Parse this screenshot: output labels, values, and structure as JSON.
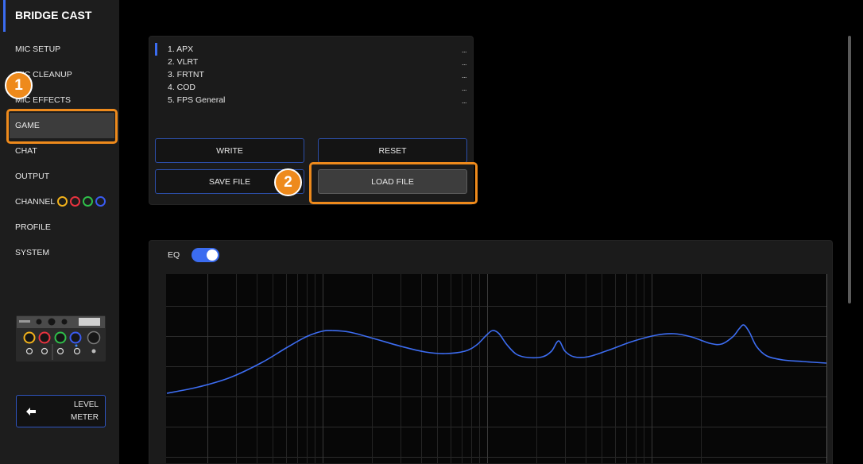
{
  "app": {
    "title": "BRIDGE CAST"
  },
  "sidebar": {
    "items": [
      {
        "label": "MIC SETUP"
      },
      {
        "label": "MIC CLEANUP"
      },
      {
        "label": "MIC EFFECTS"
      },
      {
        "label": "GAME",
        "selected": true
      },
      {
        "label": "CHAT"
      },
      {
        "label": "OUTPUT"
      },
      {
        "label": "CHANNEL"
      },
      {
        "label": "PROFILE"
      },
      {
        "label": "SYSTEM"
      }
    ],
    "channel_colors": [
      "#f2b21b",
      "#e8333f",
      "#2fbf4a",
      "#3a5bf0"
    ],
    "level_meter": {
      "line1": "LEVEL",
      "line2": "METER",
      "icon": "arrow-left-icon"
    }
  },
  "presets": {
    "items": [
      {
        "label": "1. APX",
        "menu": "...",
        "selected": true
      },
      {
        "label": "2. VLRT",
        "menu": "..."
      },
      {
        "label": "3. FRTNT",
        "menu": "..."
      },
      {
        "label": "4. COD",
        "menu": "..."
      },
      {
        "label": "5. FPS General",
        "menu": "..."
      }
    ]
  },
  "buttons": {
    "write": "WRITE",
    "reset": "RESET",
    "save_file": "SAVE FILE",
    "load_file": "LOAD FILE"
  },
  "eq": {
    "label": "EQ",
    "enabled": true
  },
  "annotations": [
    {
      "number": "1"
    },
    {
      "number": "2"
    }
  ],
  "colors": {
    "accent": "#3b6cf0",
    "annotation": "#ee8a1c",
    "sidebar_bg": "#1d1d1d",
    "main_bg": "#000000"
  }
}
